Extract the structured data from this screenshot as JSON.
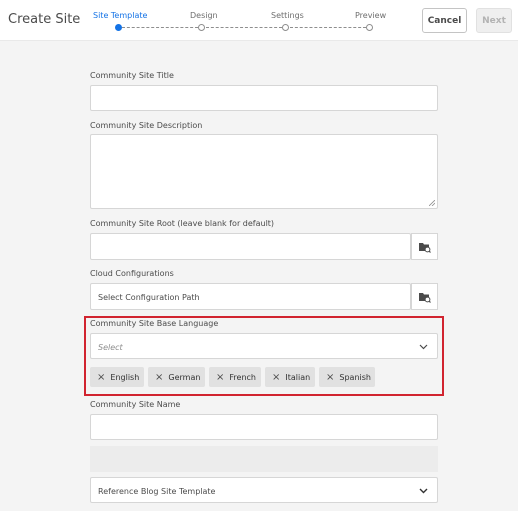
{
  "header": {
    "title": "Create Site",
    "steps": [
      {
        "label": "Site Template",
        "active": true
      },
      {
        "label": "Design",
        "active": false
      },
      {
        "label": "Settings",
        "active": false
      },
      {
        "label": "Preview",
        "active": false
      }
    ],
    "cancel_label": "Cancel",
    "next_label": "Next"
  },
  "form": {
    "site_title_label": "Community Site Title",
    "site_title_value": "",
    "site_description_label": "Community Site Description",
    "site_description_value": "",
    "site_root_label": "Community Site Root (leave blank for default)",
    "site_root_value": "",
    "cloud_config_label": "Cloud Configurations",
    "cloud_config_value": "Select Configuration Path",
    "base_language_label": "Community Site Base Language",
    "base_language_placeholder": "Select",
    "languages": [
      "English",
      "German",
      "French",
      "Italian",
      "Spanish"
    ],
    "site_name_label": "Community Site Name",
    "site_name_value": "",
    "template_value": "Reference Blog Site Template"
  },
  "icons": {
    "browse": "folder-browse-icon",
    "remove": "close-icon",
    "dropdown": "chevron-down-icon"
  },
  "colors": {
    "accent": "#1473e6",
    "highlight": "#d1242f",
    "background": "#f4f4f4"
  }
}
